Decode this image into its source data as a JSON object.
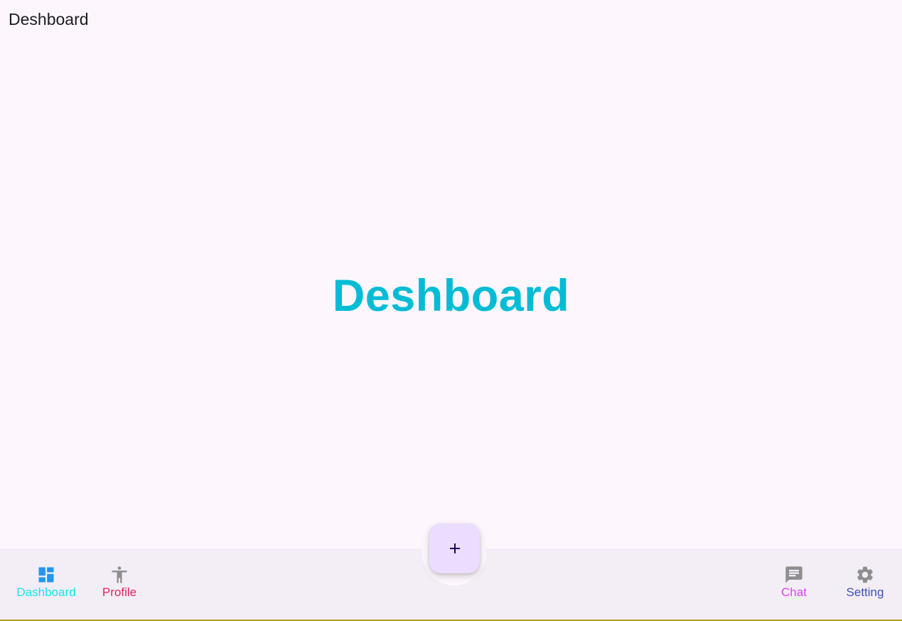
{
  "app_bar": {
    "title": "Deshboard"
  },
  "main": {
    "title": "Deshboard"
  },
  "fab": {
    "icon": "add-icon"
  },
  "bottom_nav": {
    "items": [
      {
        "label": "Dashboard",
        "icon": "dashboard-icon",
        "icon_color": "#2196f3",
        "label_color": "#18e6f0"
      },
      {
        "label": "Profile",
        "icon": "accessibility-icon",
        "icon_color": "#8e8e8e",
        "label_color": "#e0245e"
      },
      {
        "label": "Chat",
        "icon": "chat-icon",
        "icon_color": "#8e8e8e",
        "label_color": "#e040fb"
      },
      {
        "label": "Setting",
        "icon": "gear-icon",
        "icon_color": "#8e8e8e",
        "label_color": "#3f51b5"
      }
    ]
  },
  "colors": {
    "background": "#fdf7fd",
    "bar": "#f3edf6",
    "title_accent": "#00bcd4",
    "fab": "#eaddff",
    "fab_icon": "#21005d"
  }
}
